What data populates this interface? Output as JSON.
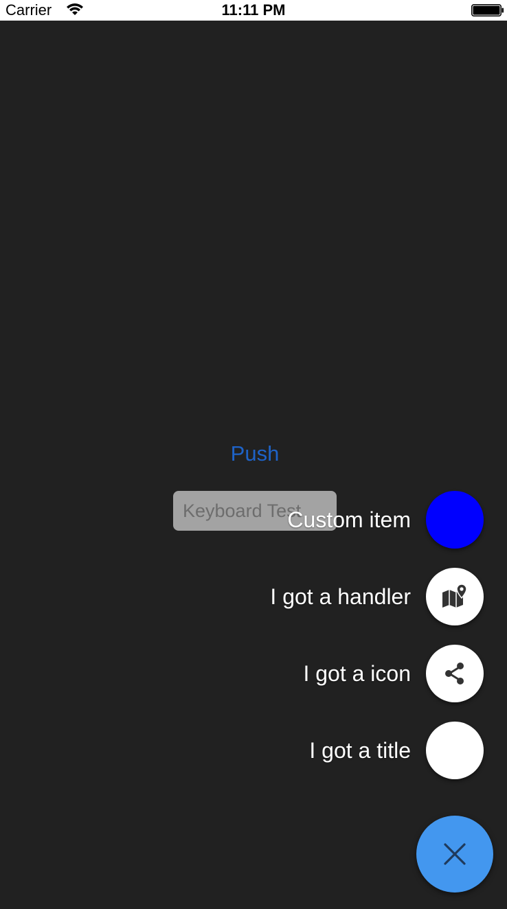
{
  "status_bar": {
    "carrier": "Carrier",
    "time": "11:11 PM",
    "wifi_icon": "wifi-icon",
    "battery_icon": "battery-icon"
  },
  "main": {
    "push_label": "Push",
    "keyboard_test_placeholder": "Keyboard Test"
  },
  "fab_menu": {
    "items": [
      {
        "label": "Custom item",
        "color": "#0000ff",
        "icon": ""
      },
      {
        "label": "I got a handler",
        "color": "#ffffff",
        "icon": "map-pin-icon"
      },
      {
        "label": "I got a icon",
        "color": "#ffffff",
        "icon": "share-icon"
      },
      {
        "label": "I got a title",
        "color": "#ffffff",
        "icon": ""
      }
    ],
    "main_button": {
      "color": "#4397ef",
      "icon": "close-icon"
    }
  },
  "colors": {
    "background": "#212121",
    "link": "#1e63c8",
    "input_bg": "#a3a3a3"
  }
}
